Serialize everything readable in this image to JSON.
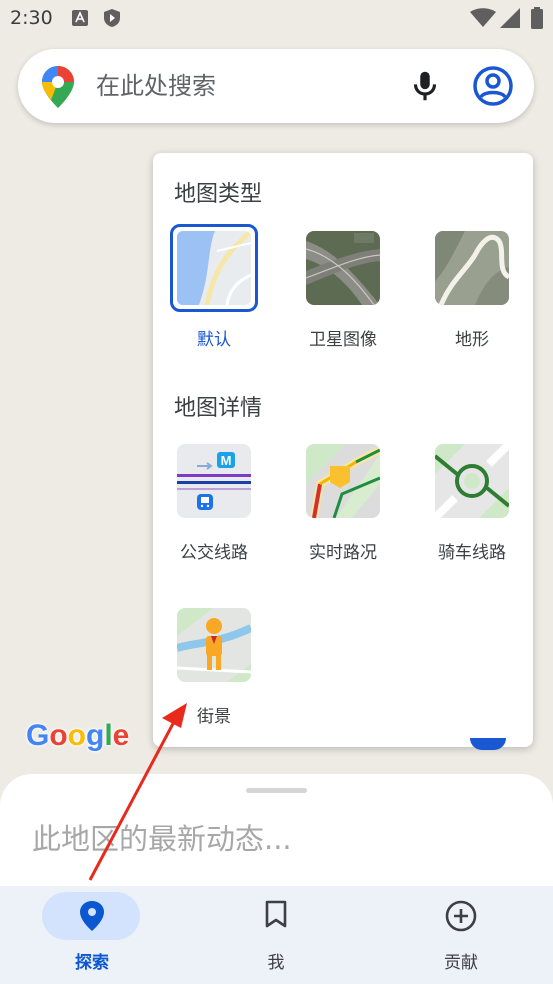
{
  "status_bar": {
    "time": "2:30"
  },
  "search": {
    "placeholder": "在此处搜索"
  },
  "layers_panel": {
    "map_type": {
      "title": "地图类型",
      "options": [
        {
          "label": "默认",
          "selected": true
        },
        {
          "label": "卫星图像",
          "selected": false
        },
        {
          "label": "地形",
          "selected": false
        }
      ]
    },
    "map_details": {
      "title": "地图详情",
      "options": [
        {
          "label": "公交线路"
        },
        {
          "label": "实时路况"
        },
        {
          "label": "骑车线路"
        },
        {
          "label": "街景"
        }
      ]
    }
  },
  "google_logo": "Google",
  "bottom_sheet": {
    "text": "此地区的最新动态..."
  },
  "bottom_nav": {
    "items": [
      {
        "label": "探索",
        "active": true
      },
      {
        "label": "我",
        "active": false
      },
      {
        "label": "贡献",
        "active": false
      }
    ]
  },
  "colors": {
    "accent": "#1a57d2",
    "nav_active_pill": "#d3e3fd",
    "annotation_arrow": "#e8291c"
  }
}
